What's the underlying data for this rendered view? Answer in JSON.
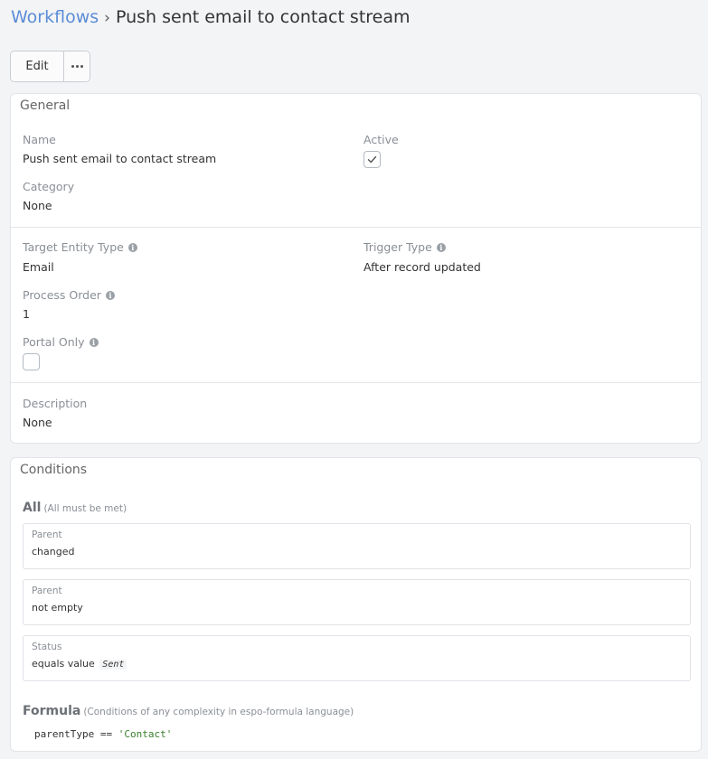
{
  "breadcrumb": {
    "parent": "Workflows",
    "separator": "›",
    "current": "Push sent email to contact stream"
  },
  "toolbar": {
    "edit_label": "Edit",
    "more_icon": "ellipsis-icon"
  },
  "general": {
    "title": "General",
    "name": {
      "label": "Name",
      "value": "Push sent email to contact stream"
    },
    "active": {
      "label": "Active",
      "checked": true
    },
    "category": {
      "label": "Category",
      "value": "None"
    },
    "target_entity_type": {
      "label": "Target Entity Type",
      "value": "Email"
    },
    "trigger_type": {
      "label": "Trigger Type",
      "value": "After record updated"
    },
    "process_order": {
      "label": "Process Order",
      "value": "1"
    },
    "portal_only": {
      "label": "Portal Only",
      "checked": false
    },
    "description": {
      "label": "Description",
      "value": "None"
    }
  },
  "conditions": {
    "title": "Conditions",
    "all": {
      "heading": "All",
      "hint": "(All must be met)"
    },
    "items": [
      {
        "field": "Parent",
        "text": "changed",
        "value": ""
      },
      {
        "field": "Parent",
        "text": "not empty",
        "value": ""
      },
      {
        "field": "Status",
        "text": "equals value",
        "value": "Sent"
      }
    ],
    "formula": {
      "heading": "Formula",
      "hint": "(Conditions of any complexity in espo-formula language)",
      "code_left": "parentType == ",
      "code_string": "'Contact'"
    }
  },
  "colors": {
    "link": "#5b8dd6",
    "background": "#f3f4f6",
    "panel": "#ffffff",
    "label": "#8a8f96",
    "string_literal": "#3a7d2c"
  }
}
